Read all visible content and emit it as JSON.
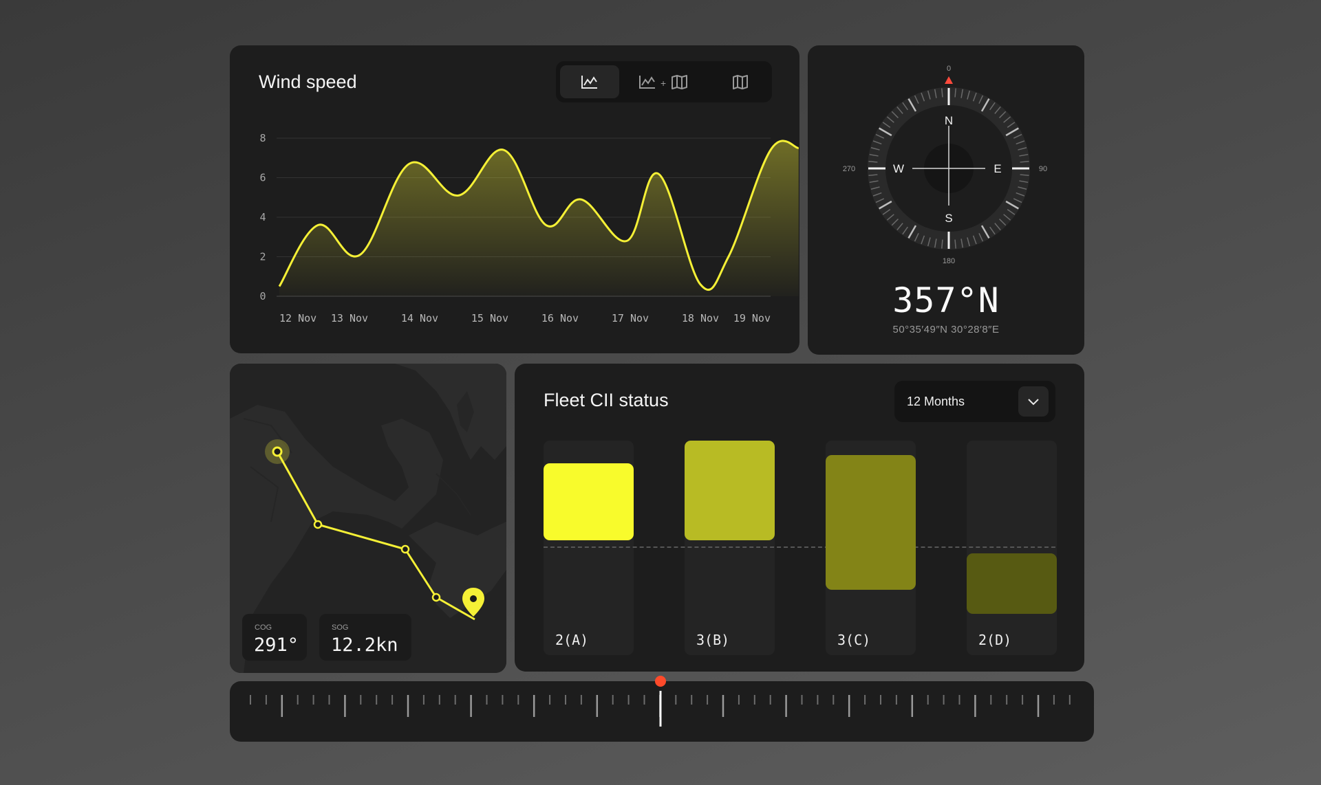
{
  "wind": {
    "title": "Wind speed",
    "view_toggle": {
      "active": "chart",
      "buttons": [
        {
          "icon": "line-chart-icon"
        },
        {
          "icon": "chart-plus-map-icon",
          "plus": "+"
        },
        {
          "icon": "map-icon"
        }
      ]
    }
  },
  "chart_data": {
    "type": "area",
    "categories": [
      "12 Nov",
      "13 Nov",
      "14 Nov",
      "15 Nov",
      "16 Nov",
      "17 Nov",
      "18 Nov",
      "19 Nov"
    ],
    "y_ticks": [
      "0",
      "2",
      "4",
      "6",
      "8"
    ],
    "ylim": [
      0,
      8
    ],
    "grid": true,
    "color": "#f5f036",
    "series": [
      {
        "x": [
          0,
          0.55,
          1.15,
          1.85,
          2.55,
          3.2,
          3.8,
          4.3,
          4.95,
          5.4,
          6.0,
          6.4,
          7.0,
          7.4
        ],
        "values": [
          0.5,
          3.6,
          2.1,
          6.7,
          5.1,
          7.4,
          3.6,
          4.9,
          2.8,
          6.2,
          0.6,
          2.0,
          7.4,
          7.5
        ]
      }
    ]
  },
  "compass": {
    "deg_labels": {
      "n": "0",
      "e": "90",
      "s": "180",
      "w": "270"
    },
    "cardinals": {
      "n": "N",
      "e": "E",
      "s": "S",
      "w": "W"
    },
    "heading_deg": 357,
    "heading_text": "357°N",
    "coords": "50°35′49″N  30°28′8″E",
    "accent": "#ff4a3c"
  },
  "map": {
    "cog": {
      "label": "COG",
      "value": "291°"
    },
    "sog": {
      "label": "SOG",
      "value": "12.2kn"
    },
    "route_color": "#f5f036"
  },
  "fleet": {
    "title": "Fleet CII status",
    "period": "12 Months",
    "columns": [
      {
        "label": "2(A)",
        "color": "#f8fb2c"
      },
      {
        "label": "3(B)",
        "color": "#b8bb24"
      },
      {
        "label": "3(C)",
        "color": "#838417"
      },
      {
        "label": "2(D)",
        "color": "#575a12"
      }
    ]
  },
  "timeline": {
    "playhead_color": "#ff4a2a"
  }
}
